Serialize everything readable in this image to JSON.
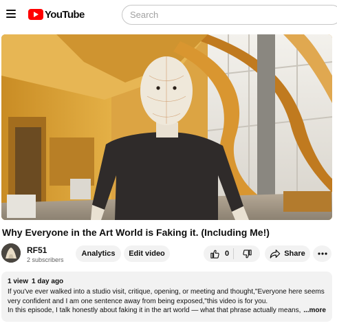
{
  "header": {
    "logo_text": "YouTube",
    "search_placeholder": "Search"
  },
  "video": {
    "title": "Why Everyone in the Art World is Faking it. (Including Me!)"
  },
  "channel": {
    "name": "RF51",
    "subscribers": "2 subscribers"
  },
  "actions": {
    "analytics_label": "Analytics",
    "edit_label": "Edit video",
    "like_count": "0",
    "share_label": "Share"
  },
  "description": {
    "views": "1 view",
    "age": "1 day ago",
    "line1": "If you've ever walked into a studio visit, critique, opening, or meeting and thought,\"Everyone here seems",
    "line2": "very confident and I am one sentence away from being exposed,\"this video is for you.",
    "line3": "In this episode, I talk honestly about faking it in the art world — what that phrase actually means,",
    "more_label": "...more"
  },
  "icons": {
    "menu": "menu-icon",
    "logo": "youtube-logo-icon",
    "like": "thumbs-up-icon",
    "dislike": "thumbs-down-icon",
    "share": "share-arrow-icon",
    "more": "more-horizontal-icon"
  },
  "colors": {
    "brand_red": "#ff0000",
    "pill_bg": "#f2f2f2",
    "text": "#0f0f0f",
    "secondary_text": "#606060"
  }
}
